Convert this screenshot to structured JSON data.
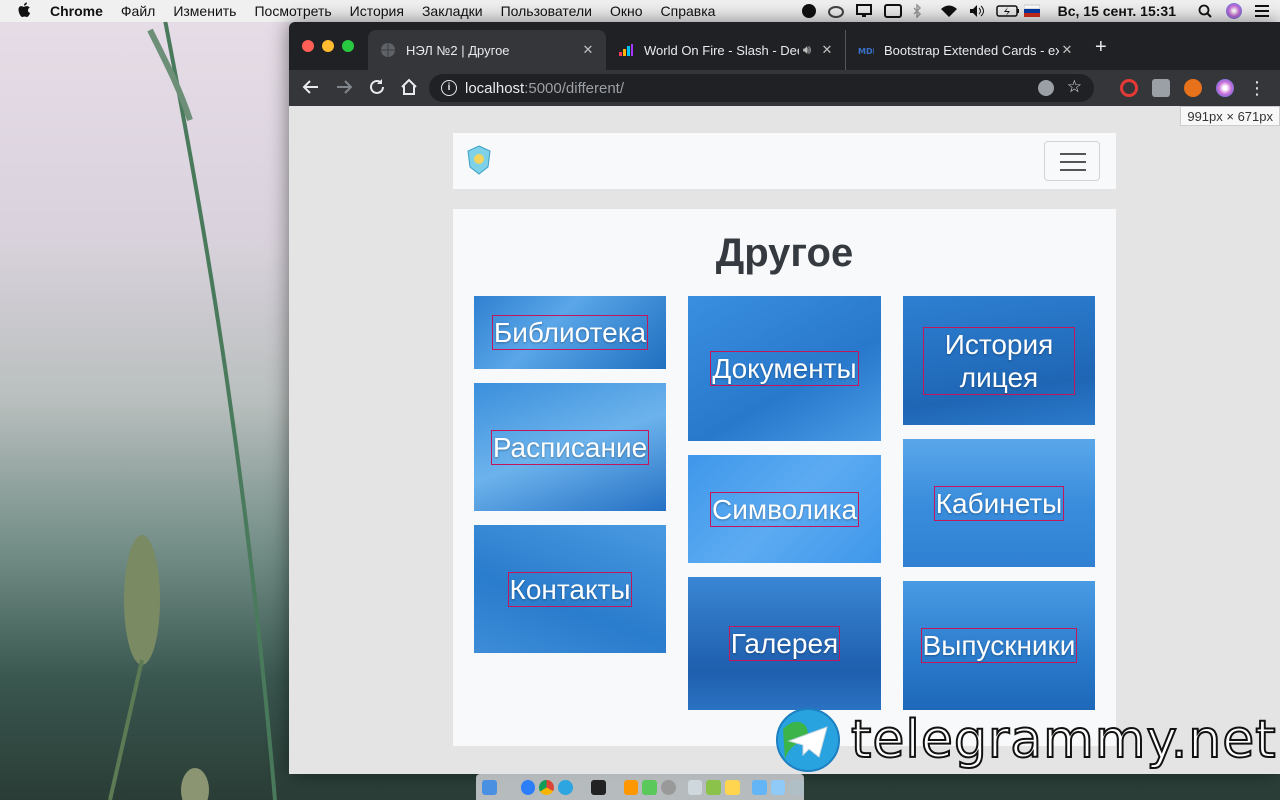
{
  "menubar": {
    "app": "Chrome",
    "items": [
      "Файл",
      "Изменить",
      "Посмотреть",
      "История",
      "Закладки",
      "Пользователи",
      "Окно",
      "Справка"
    ],
    "clock": "Вс, 15 сент.  15:31"
  },
  "browser": {
    "tabs": [
      {
        "title": "НЭЛ №2 | Другое",
        "icon": "globe-icon"
      },
      {
        "title": "World On Fire - Slash - Dee",
        "icon": "deezer-icon"
      },
      {
        "title": "Bootstrap Extended Cards - ex",
        "icon": "mdb-icon"
      }
    ],
    "url_host": "localhost",
    "url_path": ":5000/different/",
    "dimension_tooltip": "991px × 671px"
  },
  "page": {
    "heading": "Другое",
    "cards": [
      {
        "label": "Библиотека"
      },
      {
        "label": "Расписание"
      },
      {
        "label": "Контакты"
      },
      {
        "label": "Документы"
      },
      {
        "label": "Символика"
      },
      {
        "label": "Галерея"
      },
      {
        "label": "История лицея"
      },
      {
        "label": "Кабинеты"
      },
      {
        "label": "Выпускники"
      }
    ]
  },
  "watermark": {
    "text": "telegrammy.net"
  },
  "colors": {
    "card_overlay": "#2a86d8",
    "label_outline": "#c2185b",
    "tabbar": "#202124",
    "toolbar": "#35363a"
  }
}
